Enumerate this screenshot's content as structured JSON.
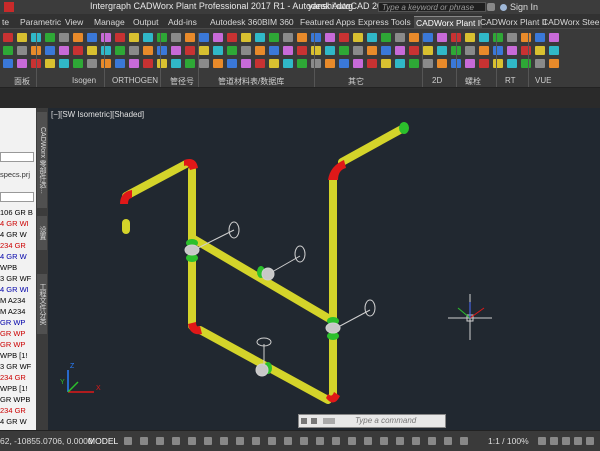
{
  "titlebar": {
    "title": "Intergraph CADWorx Plant Professional 2017 R1 - Autodesk AutoCAD 2015",
    "filename": "yanshi.dwg",
    "search_placeholder": "Type a keyword or phrase",
    "signin_label": "Sign In"
  },
  "ribbon_tabs": [
    {
      "label": "te",
      "active": false
    },
    {
      "label": "Parametric",
      "active": false
    },
    {
      "label": "View",
      "active": false
    },
    {
      "label": "Manage",
      "active": false
    },
    {
      "label": "Output",
      "active": false
    },
    {
      "label": "Add-ins",
      "active": false
    },
    {
      "label": "Autodesk 360",
      "active": false
    },
    {
      "label": "BIM 360",
      "active": false
    },
    {
      "label": "Featured Apps",
      "active": false
    },
    {
      "label": "Express Tools",
      "active": false
    },
    {
      "label": "CADWorx Plant I",
      "active": true
    },
    {
      "label": "CADWorx Plant II",
      "active": false
    },
    {
      "label": "CADWorx Steel",
      "active": false
    }
  ],
  "ribbon_groups": [
    {
      "label": "面板"
    },
    {
      "label": "Isogen"
    },
    {
      "label": "ORTHOGEN"
    },
    {
      "label": "管径号"
    },
    {
      "label": "管道材料表/数据库"
    },
    {
      "label": "其它"
    },
    {
      "label": "2D"
    },
    {
      "label": "螺栓"
    },
    {
      "label": "RT"
    },
    {
      "label": "VUE"
    }
  ],
  "side_tabs": [
    {
      "label": "CADWorx 零部件选..."
    },
    {
      "label": "设置"
    },
    {
      "label": "工程文件分类"
    }
  ],
  "left_panel": {
    "rows": [
      {
        "text": "specs.prj",
        "color": "#333"
      },
      {
        "text": "106 GR B",
        "color": "#000"
      },
      {
        "text": "4 GR WI",
        "color": "#c00"
      },
      {
        "text": "4 GR W",
        "color": "#000"
      },
      {
        "text": "234 GR",
        "color": "#c00"
      },
      {
        "text": "4 GR W",
        "color": "#00a"
      },
      {
        "text": "WPB",
        "color": "#000"
      },
      {
        "text": "3 GR WF",
        "color": "#000"
      },
      {
        "text": "4 GR WI",
        "color": "#00a"
      },
      {
        "text": "M A234",
        "color": "#000"
      },
      {
        "text": "M A234",
        "color": "#000"
      },
      {
        "text": "GR WP",
        "color": "#00a"
      },
      {
        "text": "GR WP",
        "color": "#c00"
      },
      {
        "text": "GR WP",
        "color": "#c00"
      },
      {
        "text": "WPB [1!",
        "color": "#000"
      },
      {
        "text": "3 GR WF",
        "color": "#000"
      },
      {
        "text": "234 GR",
        "color": "#c00"
      },
      {
        "text": "WPB [1!",
        "color": "#000"
      },
      {
        "text": "GR WPB",
        "color": "#000"
      },
      {
        "text": "234 GR",
        "color": "#c00"
      },
      {
        "text": "4 GR W",
        "color": "#000"
      }
    ]
  },
  "viewport": {
    "label": "[−][SW Isometric][Shaded]",
    "axis_x": "X",
    "axis_y": "Y",
    "axis_z": "Z"
  },
  "command_line": {
    "placeholder": "Type a command"
  },
  "statusbar": {
    "coords": "62, -10855.0706, 0.0000",
    "model_label": "MODEL",
    "scale": "1:1 / 100%"
  },
  "colors": {
    "pipe": "#d4d42a",
    "elbow": "#e01818",
    "flange": "#2cc02c",
    "valve": "#c8c8c8",
    "viewport_bg": "#212830"
  }
}
